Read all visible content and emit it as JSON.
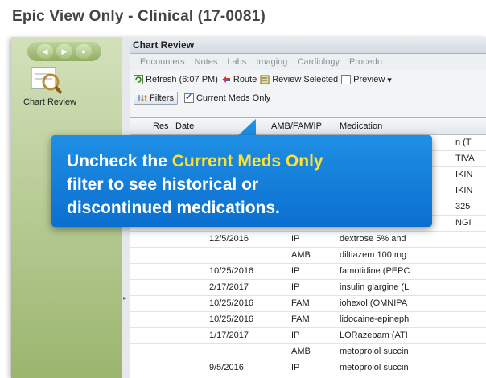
{
  "window": {
    "title": "Epic View Only - Clinical (17-0081)"
  },
  "left_pane": {
    "label": "Chart Review",
    "nav": [
      "back-icon",
      "forward-icon",
      "home-icon"
    ]
  },
  "panel": {
    "title": "Chart Review",
    "tabs": [
      "Encounters",
      "Notes",
      "Labs",
      "Imaging",
      "Cardiology",
      "Procedu"
    ],
    "toolbar1": {
      "refresh": "Refresh (6:07 PM)",
      "route": "Route",
      "review": "Review Selected",
      "preview": "Preview"
    },
    "toolbar2": {
      "filters": "Filters",
      "current_meds": "Current Meds Only",
      "current_meds_checked": true
    },
    "grid": {
      "headers": [
        "Res",
        "Date",
        "AMB/FAM/IP",
        "Medication"
      ],
      "hidden_rows": [
        {
          "med": "n (T"
        },
        {
          "med": "TIVA"
        },
        {
          "med": "IKIN"
        },
        {
          "med": "IKIN"
        },
        {
          "med": "325"
        },
        {
          "med": "NGI"
        }
      ],
      "rows": [
        {
          "date": "12/5/2016",
          "type": "IP",
          "med": "dextrose 5% and"
        },
        {
          "date": "",
          "type": "AMB",
          "med": "diltiazem 100 mg"
        },
        {
          "date": "10/25/2016",
          "type": "IP",
          "med": "famotidine (PEPC"
        },
        {
          "date": "2/17/2017",
          "type": "IP",
          "med": "insulin glargine (L"
        },
        {
          "date": "10/25/2016",
          "type": "FAM",
          "med": "iohexol (OMNIPA"
        },
        {
          "date": "10/25/2016",
          "type": "FAM",
          "med": "lidocaine-epineph"
        },
        {
          "date": "1/17/2017",
          "type": "IP",
          "med": "LORazepam (ATI"
        },
        {
          "date": "",
          "type": "AMB",
          "med": "metoprolol succin"
        },
        {
          "date": "9/5/2016",
          "type": "IP",
          "med": "metoprolol succin"
        }
      ]
    }
  },
  "callout": {
    "line1_pre": "Uncheck the ",
    "line1_highlight": "Current Meds Only",
    "line2": "filter to see historical or",
    "line3": "discontinued medications."
  }
}
